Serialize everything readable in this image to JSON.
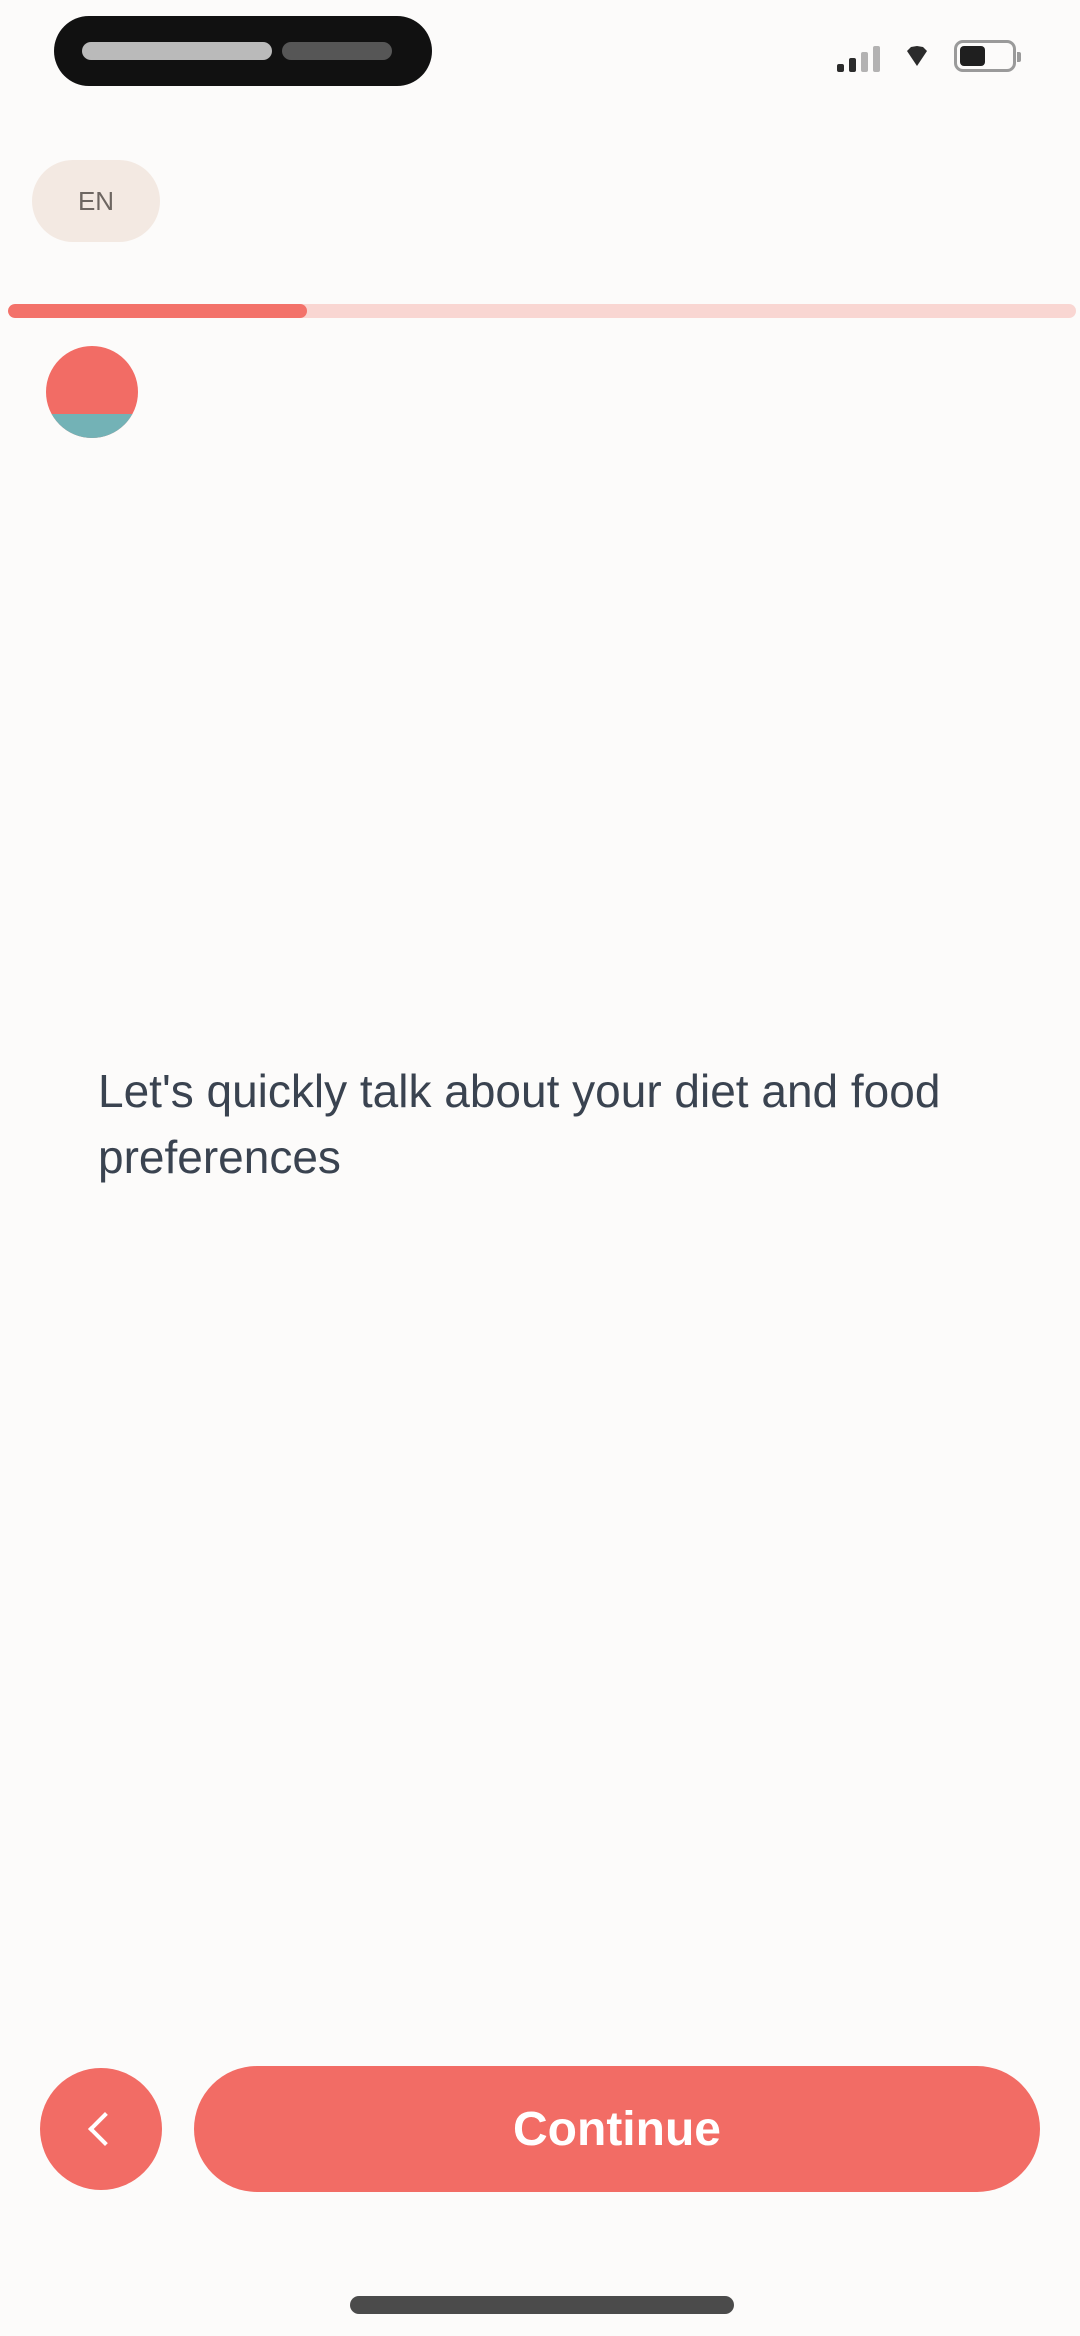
{
  "status_bar": {
    "signal_bars": 4,
    "battery_level": 0.5,
    "icons": [
      "signal-icon",
      "wifi-icon",
      "battery-icon"
    ]
  },
  "header": {
    "language_chip": "EN"
  },
  "progress": {
    "value": 0.28,
    "fill_color": "#f3726a",
    "track_color": "#f9d6d2"
  },
  "conversation": {
    "message": "Let's quickly talk about your diet and food preferences"
  },
  "footer": {
    "back_icon": "chevron-left-icon",
    "continue_label": "Continue"
  },
  "colors": {
    "accent": "#f26c65",
    "chip_background": "#f3e9e2",
    "text": "#3a4350",
    "background": "#fcfbfa"
  }
}
